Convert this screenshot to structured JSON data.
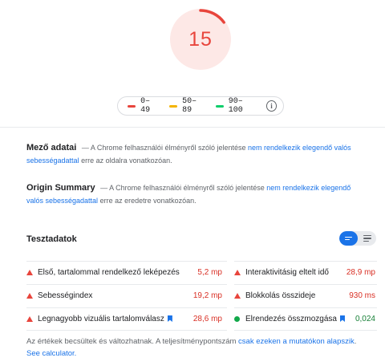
{
  "score": {
    "value": "15",
    "fraction": 0.15,
    "color": "#e8453c",
    "track_color": "#fde8e6"
  },
  "legend": {
    "items": [
      {
        "label": "0–49",
        "color": "#e8453c"
      },
      {
        "label": "50–89",
        "color": "#f4b400"
      },
      {
        "label": "90–100",
        "color": "#0cce6b"
      }
    ],
    "info_icon": "info-icon"
  },
  "field_data": {
    "title": "Mező adatai",
    "dash": "—",
    "text_before": "A Chrome felhasználói élményről szóló jelentése",
    "link": "nem rendelkezik elegendő valós sebességadattal",
    "text_after": "erre az oldalra vonatkozóan."
  },
  "origin_summary": {
    "title": "Origin Summary",
    "dash": "—",
    "text_before": "A Chrome felhasználói élményről szóló jelentése",
    "link": "nem rendelkezik elegendő valós sebességadattal",
    "text_after": "erre az eredetre vonatkozóan."
  },
  "lab_data": {
    "title": "Tesztadatok",
    "view_toggle": {
      "active": "compact",
      "icons": [
        "compact-view-icon",
        "expanded-view-icon"
      ]
    },
    "metrics": [
      {
        "name": "Első, tartalommal rendelkező leképezés",
        "value": "5,2 mp",
        "status": "bad"
      },
      {
        "name": "Interaktivitásig eltelt idő",
        "value": "28,9 mp",
        "status": "bad"
      },
      {
        "name": "Sebességindex",
        "value": "19,2 mp",
        "status": "bad"
      },
      {
        "name": "Blokkolás összideje",
        "value": "930 ms",
        "status": "bad"
      },
      {
        "name": "Legnagyobb vizuális tartalomválasz",
        "value": "28,6 mp",
        "status": "bad",
        "bookmark": true
      },
      {
        "name": "Elrendezés összmozgása",
        "value": "0,024",
        "status": "good",
        "bookmark": true
      }
    ]
  },
  "footnote": {
    "text": "Az értékek becsültek és változhatnak. A teljesítménypontszám",
    "link1": "csak ezeken a mutatókon alapszik",
    "separator": ".",
    "link2": "See calculator."
  },
  "colors": {
    "accent": "#1a73e8",
    "bad": "#e8453c",
    "average": "#f4b400",
    "good": "#0cce6b"
  }
}
